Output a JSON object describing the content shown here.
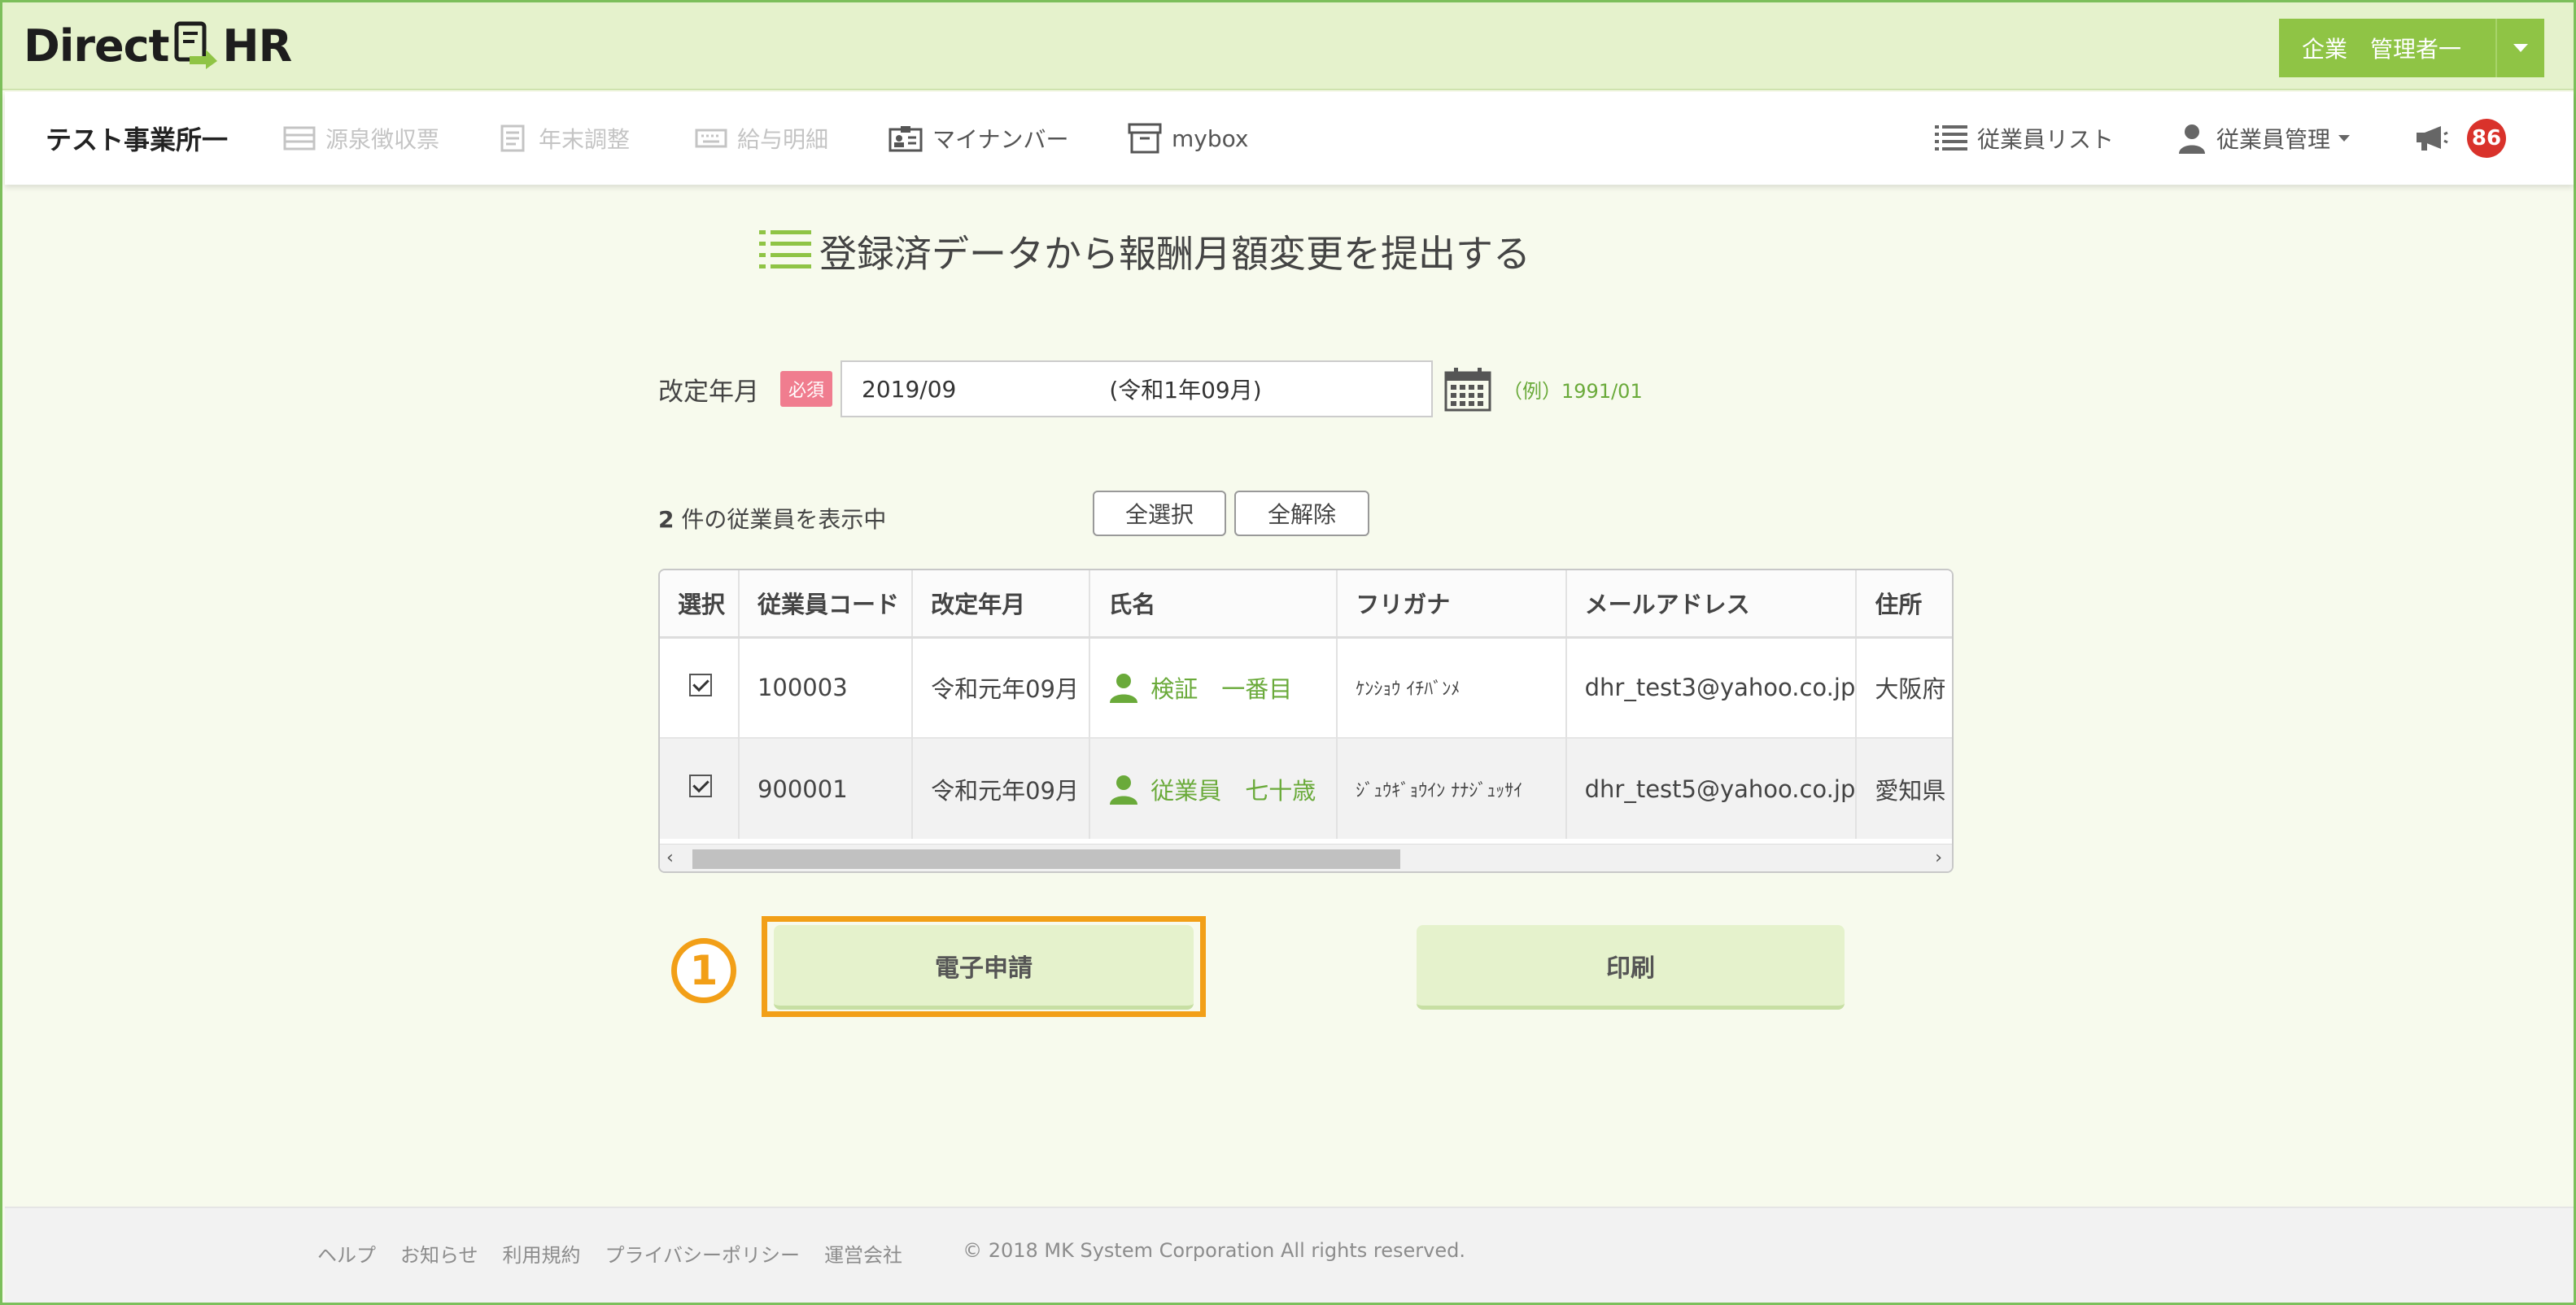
{
  "app": {
    "logo_left": "Direct",
    "logo_right": "HR"
  },
  "user_menu": {
    "label": "企業　管理者一"
  },
  "nav": {
    "office": "テスト事業所一",
    "items": [
      {
        "label": "源泉徴収票",
        "icon": "table-icon",
        "enabled": false
      },
      {
        "label": "年末調整",
        "icon": "document-icon",
        "enabled": false
      },
      {
        "label": "給与明細",
        "icon": "keyboard-icon",
        "enabled": false
      },
      {
        "label": "マイナンバー",
        "icon": "id-card-icon",
        "enabled": true
      },
      {
        "label": "mybox",
        "icon": "box-icon",
        "enabled": true
      }
    ],
    "right": {
      "employee_list": "従業員リスト",
      "employee_manage": "従業員管理",
      "notification_count": "86"
    }
  },
  "page": {
    "title": "登録済データから報酬月額変更を提出する"
  },
  "form": {
    "revision_label": "改定年月",
    "required_badge": "必須",
    "date_value": "2019/09",
    "era_value": "(令和1年09月)",
    "example": "（例）1991/01"
  },
  "list": {
    "count": "2",
    "count_suffix": " 件の従業員を表示中",
    "select_all": "全選択",
    "deselect_all": "全解除",
    "columns": [
      "選択",
      "従業員コード",
      "改定年月",
      "氏名",
      "フリガナ",
      "メールアドレス",
      "住所"
    ],
    "rows": [
      {
        "checked": true,
        "code": "100003",
        "revision": "令和元年09月",
        "name": "検証　一番目",
        "kana": "ｹﾝｼｮｳ ｲﾁﾊﾞﾝﾒ",
        "email": "dhr_test3@yahoo.co.jp",
        "address": "大阪府"
      },
      {
        "checked": true,
        "code": "900001",
        "revision": "令和元年09月",
        "name": "従業員　七十歳",
        "kana": "ｼﾞｭｳｷﾞｮｳｲﾝ ﾅﾅｼﾞｭｯｻｲ",
        "email": "dhr_test5@yahoo.co.jp",
        "address": "愛知県"
      }
    ]
  },
  "actions": {
    "step_marker": "1",
    "e_apply": "電子申請",
    "print": "印刷"
  },
  "footer": {
    "links": [
      "ヘルプ",
      "お知らせ",
      "利用規約",
      "プライバシーポリシー",
      "運営会社"
    ],
    "copyright": "© 2018 MK System Corporation All rights reserved."
  },
  "colors": {
    "accent_green": "#8fc445",
    "highlight_orange": "#f29f17",
    "badge_red": "#d9322b"
  }
}
